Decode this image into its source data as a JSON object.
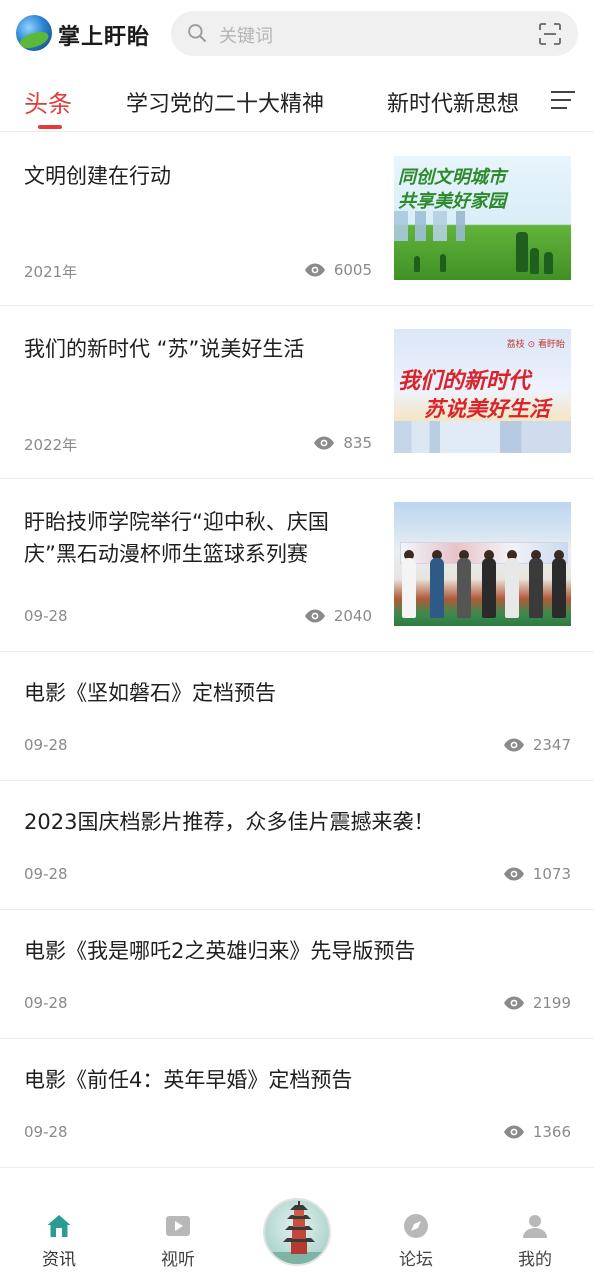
{
  "app": {
    "brand": "掌上盱眙"
  },
  "search": {
    "placeholder": "关键词"
  },
  "tabs": [
    {
      "label": "头条",
      "active": true
    },
    {
      "label": "学习党的二十大精神",
      "active": false
    },
    {
      "label": "新时代新思想",
      "active": false
    }
  ],
  "feed": [
    {
      "title": "文明创建在行动",
      "date": "2021年",
      "views": "6005",
      "thumb": "image-1"
    },
    {
      "title": "我们的新时代 “苏”说美好生活",
      "date": "2022年",
      "views": "835",
      "thumb": "image-2"
    },
    {
      "title": "盱眙技师学院举行“迎中秋、庆国庆”黑石动漫杯师生篮球系列赛",
      "date": "09-28",
      "views": "2040",
      "thumb": "image-3"
    },
    {
      "title": "电影《坚如磐石》定档预告",
      "date": "09-28",
      "views": "2347"
    },
    {
      "title": "2023国庆档影片推荐，众多佳片震撼来袭！",
      "date": "09-28",
      "views": "1073"
    },
    {
      "title": "电影《我是哪吒2之英雄归来》先导版预告",
      "date": "09-28",
      "views": "2199"
    },
    {
      "title": "电影《前任4：英年早婚》定档预告",
      "date": "09-28",
      "views": "1366"
    }
  ],
  "thumbs": {
    "t1_text": "同创文明城市\n共享美好家园",
    "t2_line1": "我们的新时代",
    "t2_line2": "苏说美好生活",
    "t2_logos": "荔枝 ⊙ 看盱眙"
  },
  "bottom_nav": [
    {
      "label": "资讯",
      "icon": "home-icon",
      "active": true
    },
    {
      "label": "视听",
      "icon": "play-icon",
      "active": false
    },
    {
      "label": "",
      "icon": "pagoda-icon",
      "active": false
    },
    {
      "label": "论坛",
      "icon": "compass-icon",
      "active": false
    },
    {
      "label": "我的",
      "icon": "user-icon",
      "active": false
    }
  ],
  "colors": {
    "accent": "#e03c3c",
    "nav_active": "#2a9d8f",
    "muted": "#8a8a8a"
  }
}
